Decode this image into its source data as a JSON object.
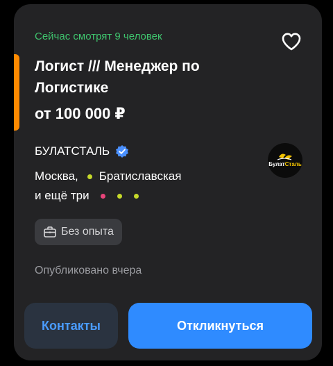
{
  "card": {
    "viewers_text": "Сейчас смотрят 9 человек",
    "title": "Логист /// Менеджер по Логистике",
    "salary": "от 100 000 ₽",
    "company": {
      "name": "БУЛАТСТАЛЬ",
      "verified": true,
      "logo_text_part1": "Булат",
      "logo_text_part2": "Сталь"
    },
    "location": {
      "city": "Москва,",
      "metro": "Братиславская",
      "more": "и ещё три",
      "metro_color": "#c6d92a",
      "more_dot_colors": [
        "#e8447a",
        "#c6d92a",
        "#c6d92a"
      ]
    },
    "experience_badge": "Без опыта",
    "published": "Опубликовано вчера",
    "actions": {
      "contacts": "Контакты",
      "apply": "Откликнуться"
    },
    "colors": {
      "accent_stripe": "#ff8a00",
      "viewers": "#3fc46e",
      "primary": "#2f8bff",
      "verified": "#4a90ff"
    }
  }
}
